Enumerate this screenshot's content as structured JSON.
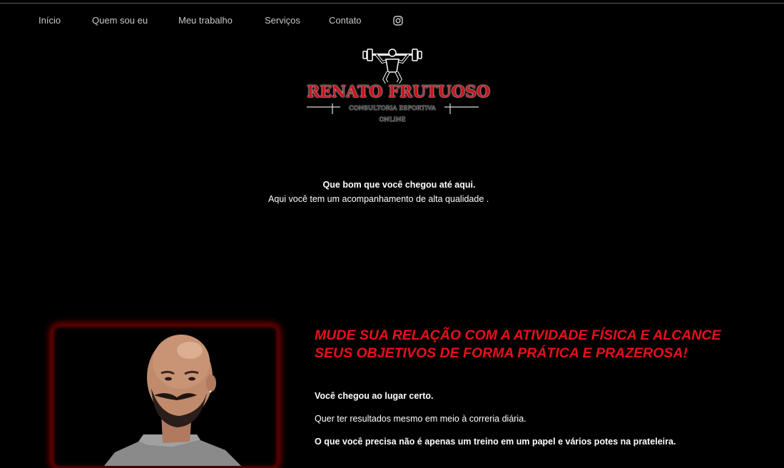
{
  "nav": {
    "items": [
      {
        "label": "Início"
      },
      {
        "label": "Quem sou eu"
      },
      {
        "label": "Meu trabalho"
      },
      {
        "label": "Serviços"
      },
      {
        "label": "Contato"
      }
    ],
    "social_icon": "instagram-icon"
  },
  "logo": {
    "name": "RENATO FRUTUOSO",
    "subtitle": "CONSULTORIA ESPORTIVA",
    "online": "ONLINE"
  },
  "welcome": {
    "title": "Que bom que você chegou até aqui.",
    "subtitle": "Aqui você tem um acompanhamento de alta qualidade ."
  },
  "about": {
    "headline": "MUDE SUA RELAÇÃO COM A ATIVIDADE FÍSICA E ALCANCE SEUS OBJETIVOS DE FORMA PRÁTICA E PRAZEROSA!",
    "p1": "Você chegou ao lugar certo.",
    "p2": "Quer ter resultados mesmo em meio à correria diária.",
    "p3": "O que você precisa não é apenas um treino em um papel e vários potes na prateleira."
  },
  "colors": {
    "background": "#000000",
    "accent": "#e8101c",
    "nav_text": "#c8c8c8"
  }
}
